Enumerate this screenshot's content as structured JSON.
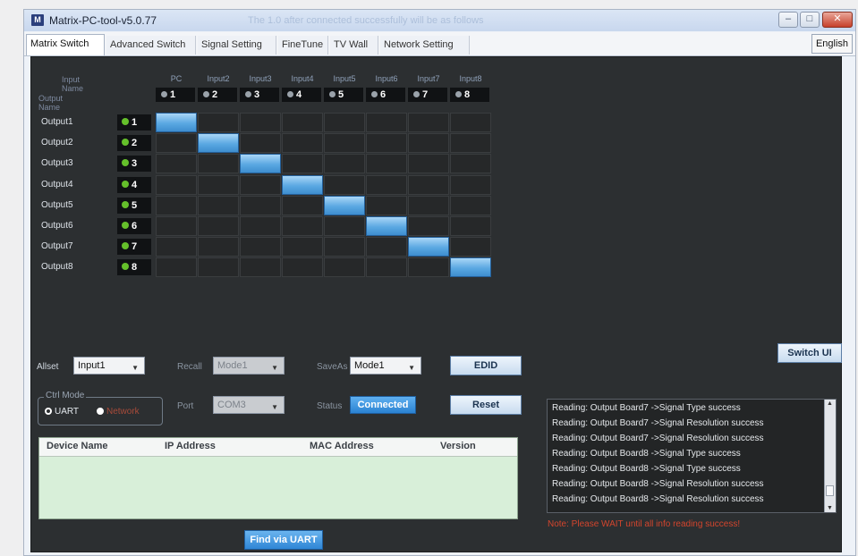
{
  "window": {
    "icon_text": "M",
    "title": "Matrix-PC-tool-v5.0.77",
    "title_status": "The 1.0 after connected successfully will be as follows"
  },
  "tabs": [
    {
      "label": "Matrix Switch",
      "active": true
    },
    {
      "label": "Advanced Switch",
      "active": false
    },
    {
      "label": "Signal Setting",
      "active": false
    },
    {
      "label": "FineTune",
      "active": false
    },
    {
      "label": "TV Wall",
      "active": false
    },
    {
      "label": "Network Setting",
      "active": false
    }
  ],
  "language_button": "English",
  "matrix": {
    "corner_input": "Input Name",
    "corner_output": "Output Name",
    "inputs": [
      {
        "name": "PC",
        "num": "1"
      },
      {
        "name": "Input2",
        "num": "2"
      },
      {
        "name": "Input3",
        "num": "3"
      },
      {
        "name": "Input4",
        "num": "4"
      },
      {
        "name": "Input5",
        "num": "5"
      },
      {
        "name": "Input6",
        "num": "6"
      },
      {
        "name": "Input7",
        "num": "7"
      },
      {
        "name": "Input8",
        "num": "8"
      }
    ],
    "outputs": [
      {
        "name": "Output1",
        "num": "1",
        "routed_input": 1
      },
      {
        "name": "Output2",
        "num": "2",
        "routed_input": 2
      },
      {
        "name": "Output3",
        "num": "3",
        "routed_input": 3
      },
      {
        "name": "Output4",
        "num": "4",
        "routed_input": 4
      },
      {
        "name": "Output5",
        "num": "5",
        "routed_input": 5
      },
      {
        "name": "Output6",
        "num": "6",
        "routed_input": 6
      },
      {
        "name": "Output7",
        "num": "7",
        "routed_input": 7
      },
      {
        "name": "Output8",
        "num": "8",
        "routed_input": 8
      }
    ],
    "active_cell_color": "#5aa8e2",
    "output_led_color": "#65c02b"
  },
  "controls": {
    "allset_label": "Allset",
    "allset_value": "Input1",
    "recall_label": "Recall",
    "recall_value": "Mode1",
    "saveas_label": "SaveAs",
    "saveas_value": "Mode1",
    "edid_button": "EDID",
    "switch_ui_button": "Switch UI",
    "ctrl_mode_label": "Ctrl Mode",
    "ctrl_mode_uart": "UART",
    "ctrl_mode_network": "Network",
    "ctrl_mode_selected": "UART",
    "port_label": "Port",
    "port_value": "COM3",
    "status_label": "Status",
    "status_value": "Connected",
    "reset_button": "Reset",
    "find_button": "Find via UART"
  },
  "device_table": {
    "columns": [
      "Device Name",
      "IP Address",
      "MAC Address",
      "Version"
    ],
    "rows": []
  },
  "log": [
    "Reading: Output Board7 ->Signal Type success",
    "Reading: Output Board7 ->Signal Resolution success",
    "Reading: Output Board7 ->Signal Resolution success",
    "Reading: Output Board8 ->Signal Type success",
    "Reading: Output Board8 ->Signal Type success",
    "Reading: Output Board8 ->Signal Resolution success",
    "Reading: Output Board8 ->Signal Resolution success"
  ],
  "note": "Note: Please WAIT until all info reading success!"
}
